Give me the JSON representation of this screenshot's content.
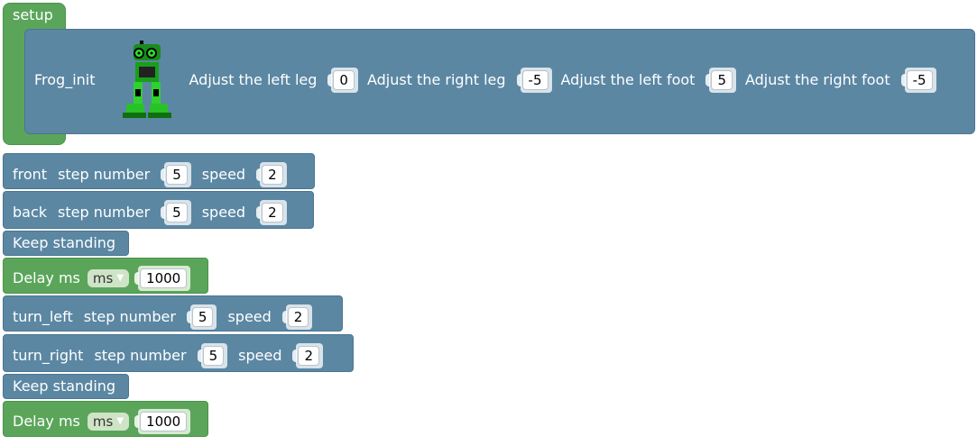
{
  "setup_block": {
    "label": "setup"
  },
  "frog_init": {
    "label": "Frog_init",
    "left_leg_label": "Adjust the left leg",
    "left_leg_value": "0",
    "right_leg_label": "Adjust the right leg",
    "right_leg_value": "-5",
    "left_foot_label": "Adjust the left foot",
    "left_foot_value": "5",
    "right_foot_label": "Adjust the right foot",
    "right_foot_value": "-5"
  },
  "front_block": {
    "label": "front",
    "step_label": "step number",
    "step_value": "5",
    "speed_label": "speed",
    "speed_value": "2"
  },
  "back_block": {
    "label": "back",
    "step_label": "step number",
    "step_value": "5",
    "speed_label": "speed",
    "speed_value": "2"
  },
  "keep_standing_1": {
    "label": "Keep standing"
  },
  "delay_1": {
    "label": "Delay ms",
    "unit": "ms",
    "value": "1000"
  },
  "turn_left_block": {
    "label": "turn_left",
    "step_label": "step number",
    "step_value": "5",
    "speed_label": "speed",
    "speed_value": "2"
  },
  "turn_right_block": {
    "label": "turn_right",
    "step_label": "step number",
    "step_value": "5",
    "speed_label": "speed",
    "speed_value": "2"
  },
  "keep_standing_2": {
    "label": "Keep standing"
  },
  "delay_2": {
    "label": "Delay ms",
    "unit": "ms",
    "value": "1000"
  },
  "colors": {
    "motion_block": "#5b87a3",
    "control_block": "#5ba55b"
  },
  "icons": {
    "frog_robot": "frog-robot-icon",
    "dropdown": "dropdown-arrow-icon"
  }
}
